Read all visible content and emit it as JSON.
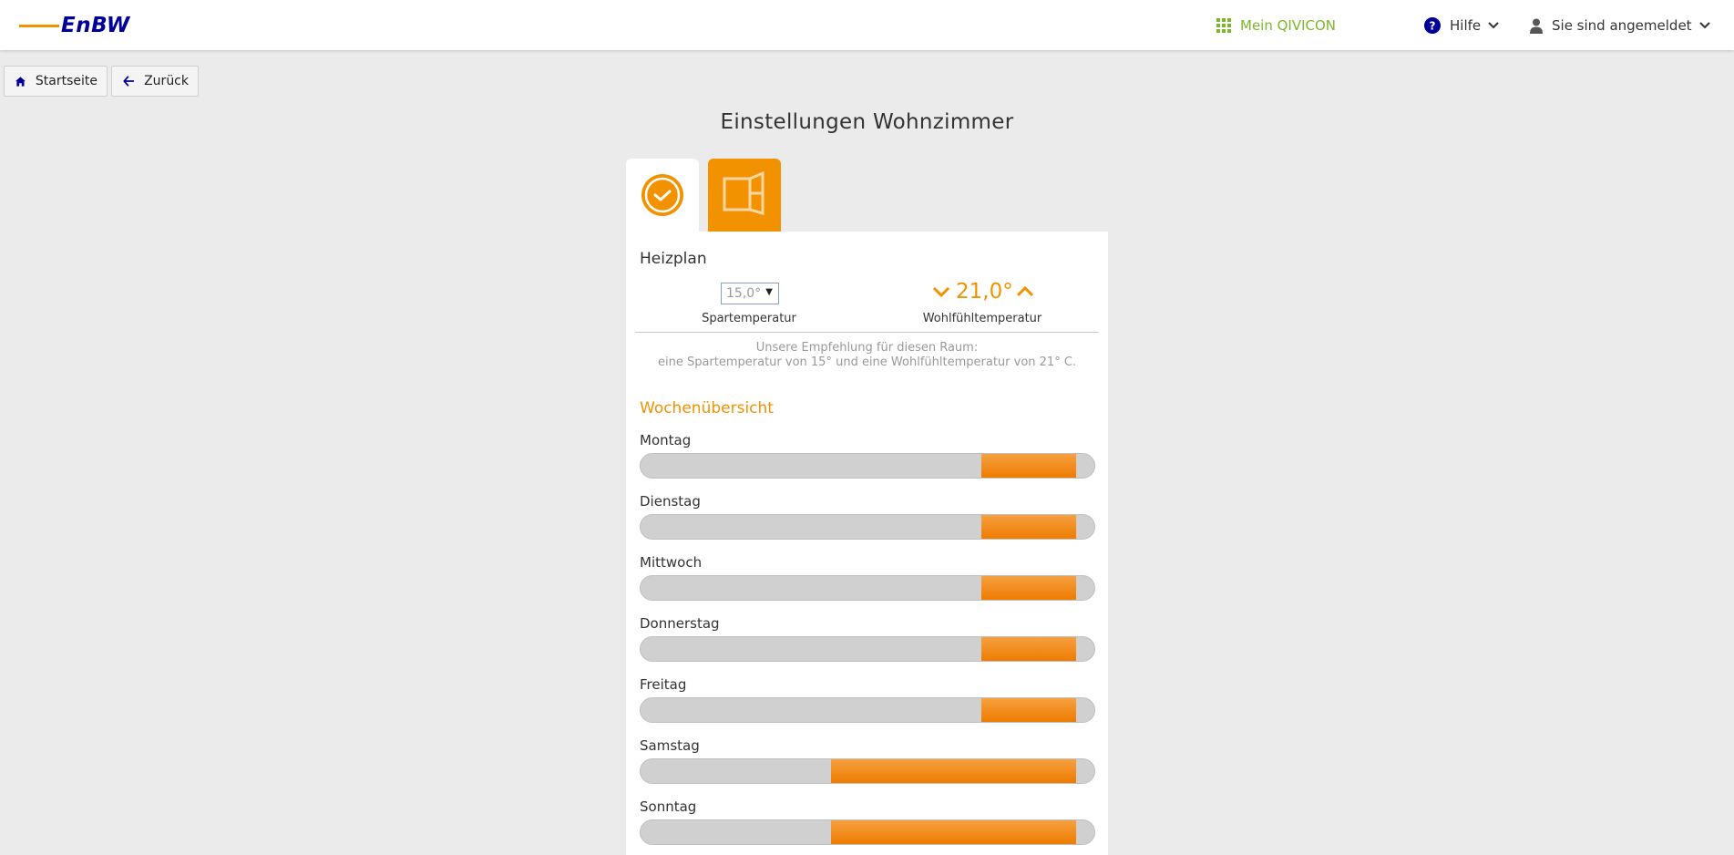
{
  "header": {
    "logo_text": "EnBW",
    "qivicon_label": "Mein QIVICON",
    "help_label": "Hilfe",
    "user_label": "Sie sind angemeldet"
  },
  "breadcrumb": {
    "home_label": "Startseite",
    "back_label": "Zurück"
  },
  "page_title": "Einstellungen Wohnzimmer",
  "heizplan": {
    "title": "Heizplan",
    "spar_value": "15,0°",
    "spar_label": "Spartemperatur",
    "comfort_value": "21,0°",
    "comfort_label": "Wohlfühltemperatur",
    "recommendation_line1": "Unsere Empfehlung für diesen Raum:",
    "recommendation_line2": "eine Spartemperatur von 15° und eine Wohlfühltemperatur von 21° C."
  },
  "week": {
    "title": "Wochenübersicht",
    "days": [
      {
        "name": "Montag",
        "comfort_start": 0.75,
        "comfort_end": 0.96
      },
      {
        "name": "Dienstag",
        "comfort_start": 0.75,
        "comfort_end": 0.96
      },
      {
        "name": "Mittwoch",
        "comfort_start": 0.75,
        "comfort_end": 0.96
      },
      {
        "name": "Donnerstag",
        "comfort_start": 0.75,
        "comfort_end": 0.96
      },
      {
        "name": "Freitag",
        "comfort_start": 0.75,
        "comfort_end": 0.96
      },
      {
        "name": "Samstag",
        "comfort_start": 0.42,
        "comfort_end": 0.96
      },
      {
        "name": "Sonntag",
        "comfort_start": 0.42,
        "comfort_end": 0.96
      }
    ]
  },
  "colors": {
    "accent": "#f39200",
    "brand": "#000099",
    "qivicon": "#7ab829"
  },
  "icons": {
    "home": "home-icon",
    "back": "arrow-left-icon",
    "help": "question-circle-icon",
    "user": "user-icon",
    "apps": "grid-icon",
    "clock": "clock-check-icon",
    "window": "window-icon"
  }
}
